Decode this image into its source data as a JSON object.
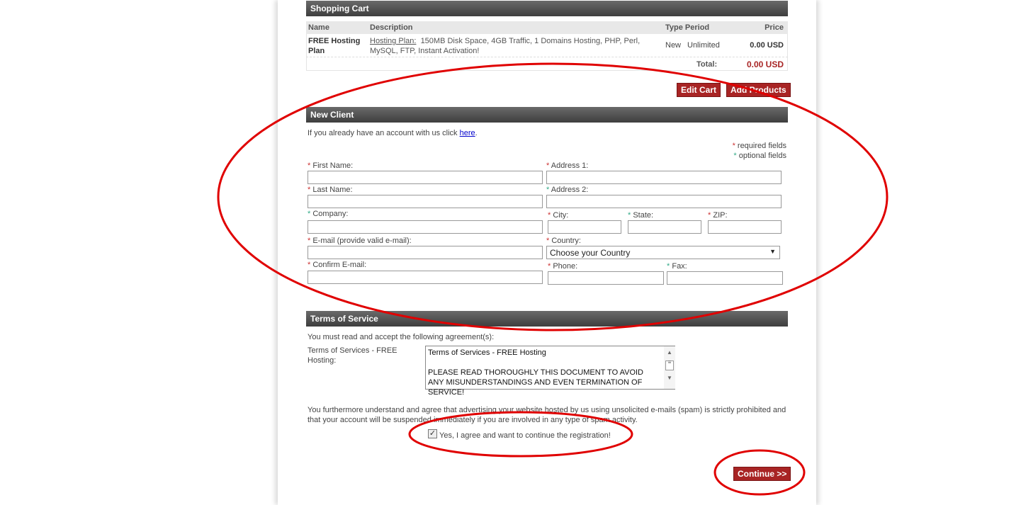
{
  "cart": {
    "title": "Shopping Cart",
    "headers": {
      "name": "Name",
      "description": "Description",
      "type_period": "Type Period",
      "price": "Price"
    },
    "row": {
      "name": "FREE Hosting Plan",
      "desc_link": "Hosting Plan:",
      "desc": "150MB Disk Space, 4GB Traffic, 1 Domains Hosting, PHP, Perl, MySQL, FTP, Instant Activation!",
      "type": "New",
      "period": "Unlimited",
      "price": "0.00 USD"
    },
    "total_label": "Total:",
    "total": "0.00 USD",
    "edit_cart": "Edit Cart",
    "add_products": "Add Products"
  },
  "client": {
    "title": "New Client",
    "intro": "If you already have an account with us click",
    "here": "here",
    "required": "required fields",
    "optional": "optional fields",
    "star": "*",
    "first_name": "First Name:",
    "last_name": "Last Name:",
    "company": "Company:",
    "email": "E-mail (provide valid e-mail):",
    "confirm_email": "Confirm E-mail:",
    "address1": "Address 1:",
    "address2": "Address 2:",
    "city": "City:",
    "state": "State:",
    "zip": "ZIP:",
    "country": "Country:",
    "country_value": "Choose your Country",
    "phone": "Phone:",
    "fax": "Fax:"
  },
  "terms": {
    "title": "Terms of Service",
    "intro": "You must read and accept the following agreement(s):",
    "label": "Terms of Services - FREE Hosting:",
    "text1": "Terms of Services - FREE Hosting",
    "text2": "PLEASE READ THOROUGHLY THIS DOCUMENT TO AVOID ANY MISUNDERSTANDINGS AND EVEN TERMINATION OF SERVICE!",
    "spam": "You furthermore understand and agree that advertising your website hosted by us using unsolicited e-mails (spam) is strictly prohibited and that your account will be suspended immediately if you are involved in any type of spam activity.",
    "agree": "Yes, I agree and want to continue the registration!",
    "agree_checked": true,
    "continue": "Continue >>"
  },
  "colors": {
    "accent": "#a82424",
    "annotation": "#e00000"
  }
}
